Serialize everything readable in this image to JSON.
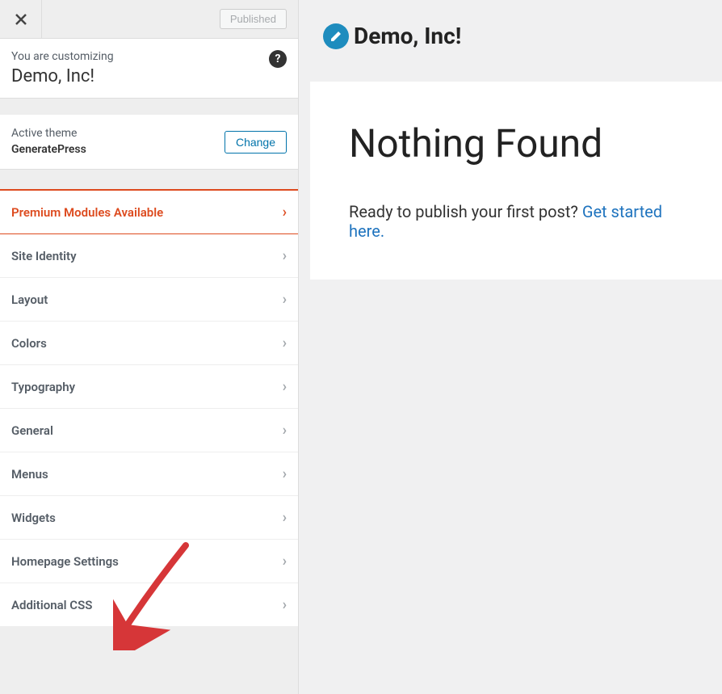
{
  "topbar": {
    "published_label": "Published"
  },
  "info": {
    "label": "You are customizing",
    "site_title": "Demo, Inc!",
    "help_char": "?"
  },
  "theme": {
    "label": "Active theme",
    "name": "GeneratePress",
    "change_label": "Change"
  },
  "menu": {
    "premium": "Premium Modules Available",
    "items": [
      "Site Identity",
      "Layout",
      "Colors",
      "Typography",
      "General",
      "Menus",
      "Widgets",
      "Homepage Settings",
      "Additional CSS"
    ]
  },
  "preview": {
    "site_title": "Demo, Inc!",
    "heading": "Nothing Found",
    "prompt": "Ready to publish your first post? ",
    "link_text": "Get started here."
  }
}
